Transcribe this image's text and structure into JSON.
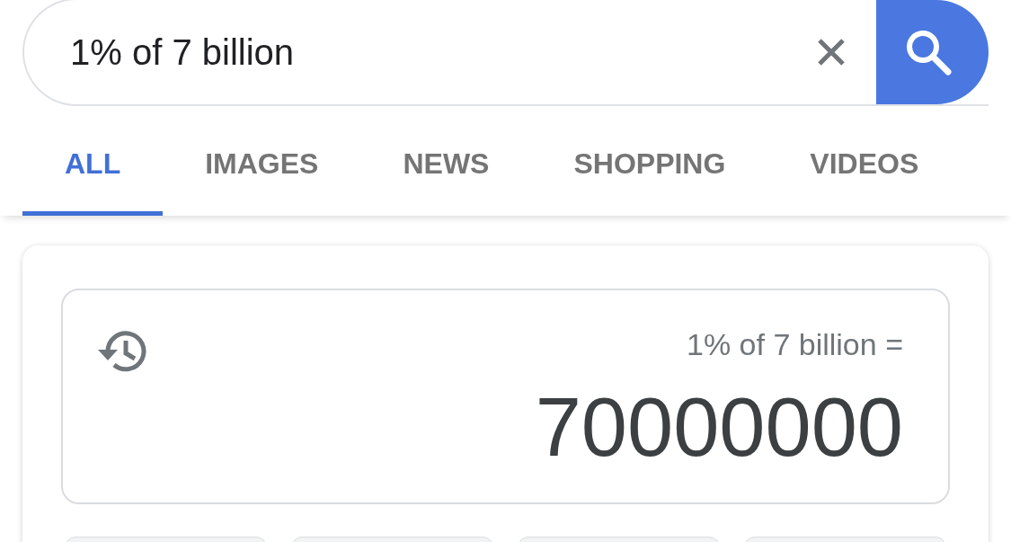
{
  "search": {
    "value": "1% of 7 billion"
  },
  "tabs": [
    {
      "label": "ALL",
      "selected": true
    },
    {
      "label": "IMAGES",
      "selected": false
    },
    {
      "label": "NEWS",
      "selected": false
    },
    {
      "label": "SHOPPING",
      "selected": false
    },
    {
      "label": "VIDEOS",
      "selected": false
    }
  ],
  "calculator": {
    "expression": "1% of 7 billion =",
    "result": "70000000",
    "keys": [
      {
        "kind": "key"
      },
      {
        "kind": "key"
      },
      {
        "kind": "key"
      },
      {
        "kind": "key"
      }
    ]
  }
}
